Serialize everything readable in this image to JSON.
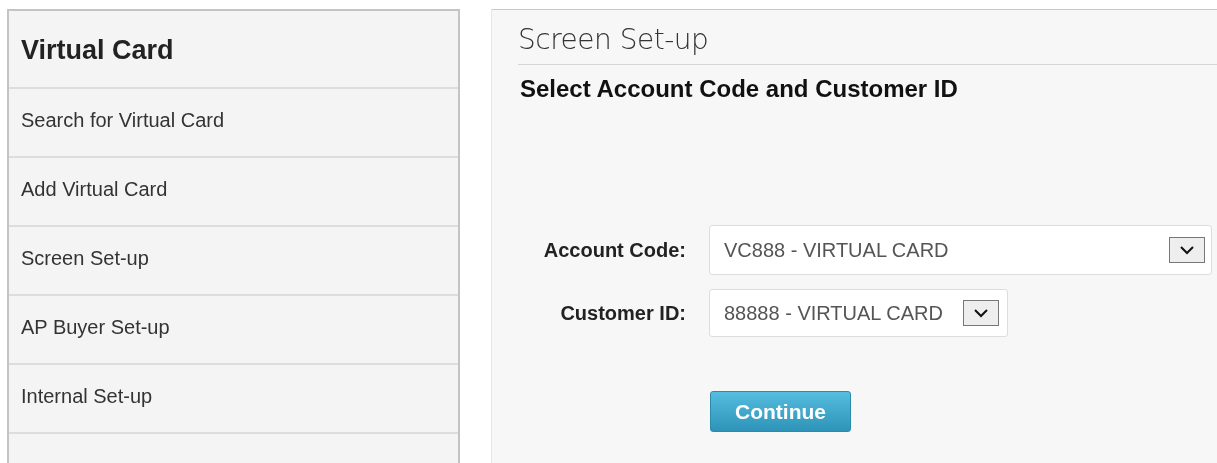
{
  "sidebar": {
    "title": "Virtual Card",
    "items": [
      {
        "label": "Search for Virtual Card"
      },
      {
        "label": "Add Virtual Card"
      },
      {
        "label": "Screen Set-up"
      },
      {
        "label": "AP Buyer Set-up"
      },
      {
        "label": "Internal Set-up"
      }
    ]
  },
  "main": {
    "title": "Screen Set-up",
    "heading": "Select Account Code and Customer ID",
    "fields": [
      {
        "label": "Account Code:",
        "value": "VC888 - VIRTUAL CARD",
        "kind": "wide"
      },
      {
        "label": "Customer ID:",
        "value": "88888 - VIRTUAL CARD",
        "kind": "narrow"
      }
    ],
    "button": "Continue"
  }
}
